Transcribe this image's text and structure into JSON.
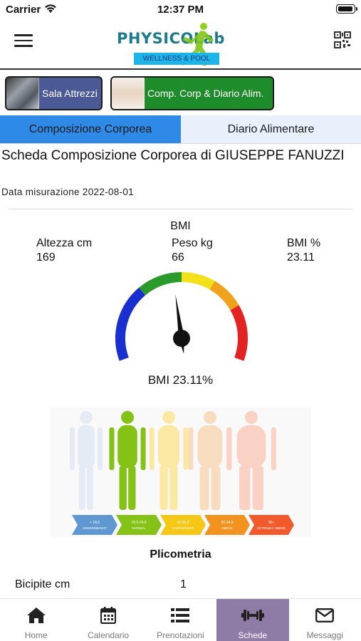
{
  "status": {
    "carrier": "Carrier",
    "time": "12:37 PM"
  },
  "header": {
    "logo_text": "PHYSICOLab",
    "logo_subtitle": "WELLNESS & POOL"
  },
  "modules": [
    {
      "label": "Sala Attrezzi"
    },
    {
      "label": "Comp. Corp & Diario Alim."
    }
  ],
  "tabs": [
    {
      "label": "Composizione Corporea",
      "active": true
    },
    {
      "label": "Diario Alimentare",
      "active": false
    }
  ],
  "sheet": {
    "title": "Scheda Composizione Corporea di GIUSEPPE FANUZZI",
    "date": "Data misurazione 2022-08-01"
  },
  "bmi": {
    "heading": "BMI",
    "stats": [
      {
        "label": "Altezza cm",
        "value": "169"
      },
      {
        "label": "Peso kg",
        "value": "66"
      },
      {
        "label": "BMI %",
        "value": "23.11"
      }
    ],
    "gauge_value": 23.11,
    "caption": "BMI 23.11%",
    "gauge_colors": [
      "#1a2fcf",
      "#2a9a2a",
      "#f2e11a",
      "#f0a21a",
      "#e32222"
    ]
  },
  "figure": {
    "categories": [
      {
        "label": "< 18,5",
        "sub": "UNDERWEIGHT",
        "color": "#5e97d1"
      },
      {
        "label": "18,5-24,9",
        "sub": "NORMAL",
        "color": "#84c215"
      },
      {
        "label": "25-29,9",
        "sub": "OVERWEIGHT",
        "color": "#f5c717"
      },
      {
        "label": "30-34,9",
        "sub": "OBESE",
        "color": "#f29320"
      },
      {
        "label": "35<",
        "sub": "EXTREMLY OBESE",
        "color": "#f15a2a"
      }
    ]
  },
  "plicometria": {
    "heading": "Plicometria",
    "rows": [
      {
        "label": "Bicipite cm",
        "value": "1"
      }
    ]
  },
  "bottom_nav": [
    {
      "label": "Home",
      "icon": "home-icon",
      "active": false
    },
    {
      "label": "Calendario",
      "icon": "calendar-icon",
      "active": false
    },
    {
      "label": "Prenotazioni",
      "icon": "list-icon",
      "active": false
    },
    {
      "label": "Schede",
      "icon": "dumbbell-icon",
      "active": true
    },
    {
      "label": "Messaggi",
      "icon": "envelope-icon",
      "active": false
    }
  ]
}
